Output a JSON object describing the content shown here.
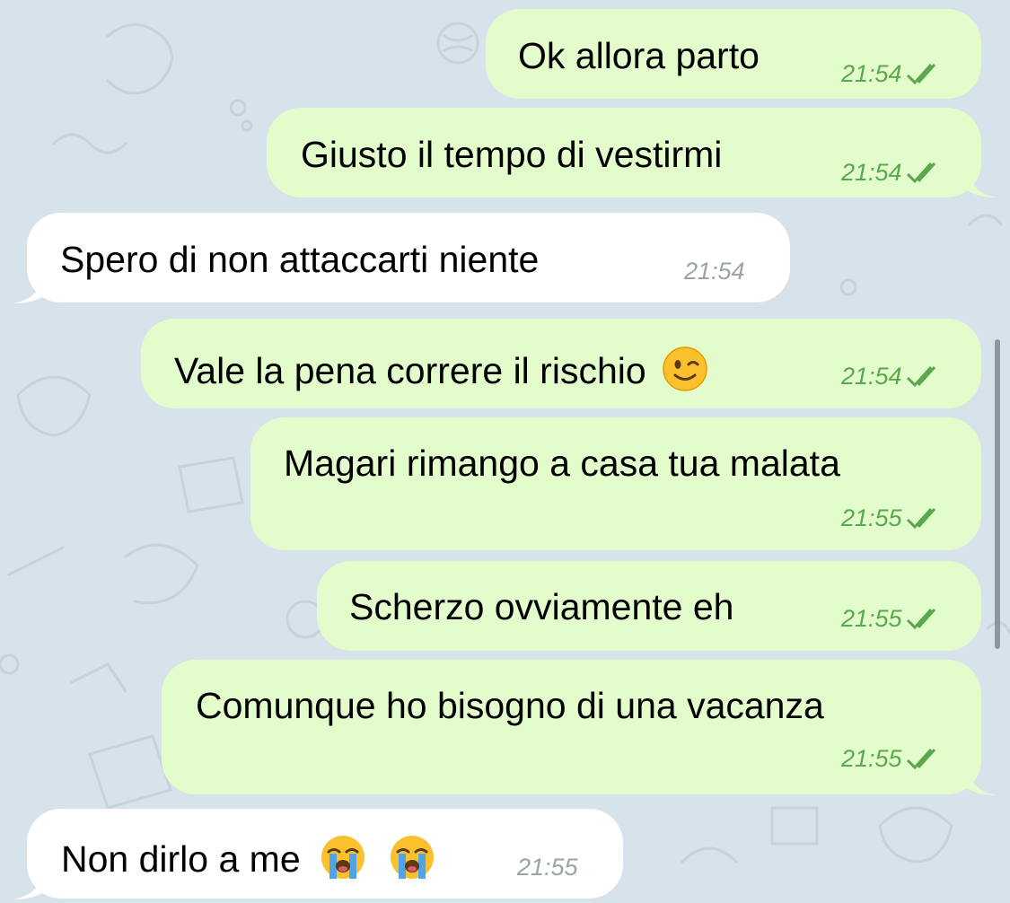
{
  "messages": [
    {
      "direction": "out",
      "text": "Ok allora parto",
      "time": "21:54",
      "read": true
    },
    {
      "direction": "out",
      "text": "Giusto il tempo di vestirmi",
      "time": "21:54",
      "read": true
    },
    {
      "direction": "in",
      "text": "Spero di non attaccarti niente",
      "time": "21:54"
    },
    {
      "direction": "out",
      "text": "Vale la pena correre il rischio",
      "emoji": [
        "winking-face"
      ],
      "time": "21:54",
      "read": true
    },
    {
      "direction": "out",
      "text": "Magari rimango a casa tua malata",
      "time": "21:55",
      "read": true
    },
    {
      "direction": "out",
      "text": "Scherzo ovviamente eh",
      "time": "21:55",
      "read": true
    },
    {
      "direction": "out",
      "text": "Comunque ho bisogno di una vacanza",
      "time": "21:55",
      "read": true
    },
    {
      "direction": "in",
      "text": "Non dirlo a me",
      "emoji": [
        "loudly-crying-face",
        "loudly-crying-face"
      ],
      "time": "21:55"
    }
  ],
  "colors": {
    "background": "#d6e3ea",
    "outgoing_bubble": "#e2fccb",
    "incoming_bubble": "#ffffff",
    "outgoing_meta": "#5ba84f",
    "incoming_meta": "#9aa3a8"
  }
}
